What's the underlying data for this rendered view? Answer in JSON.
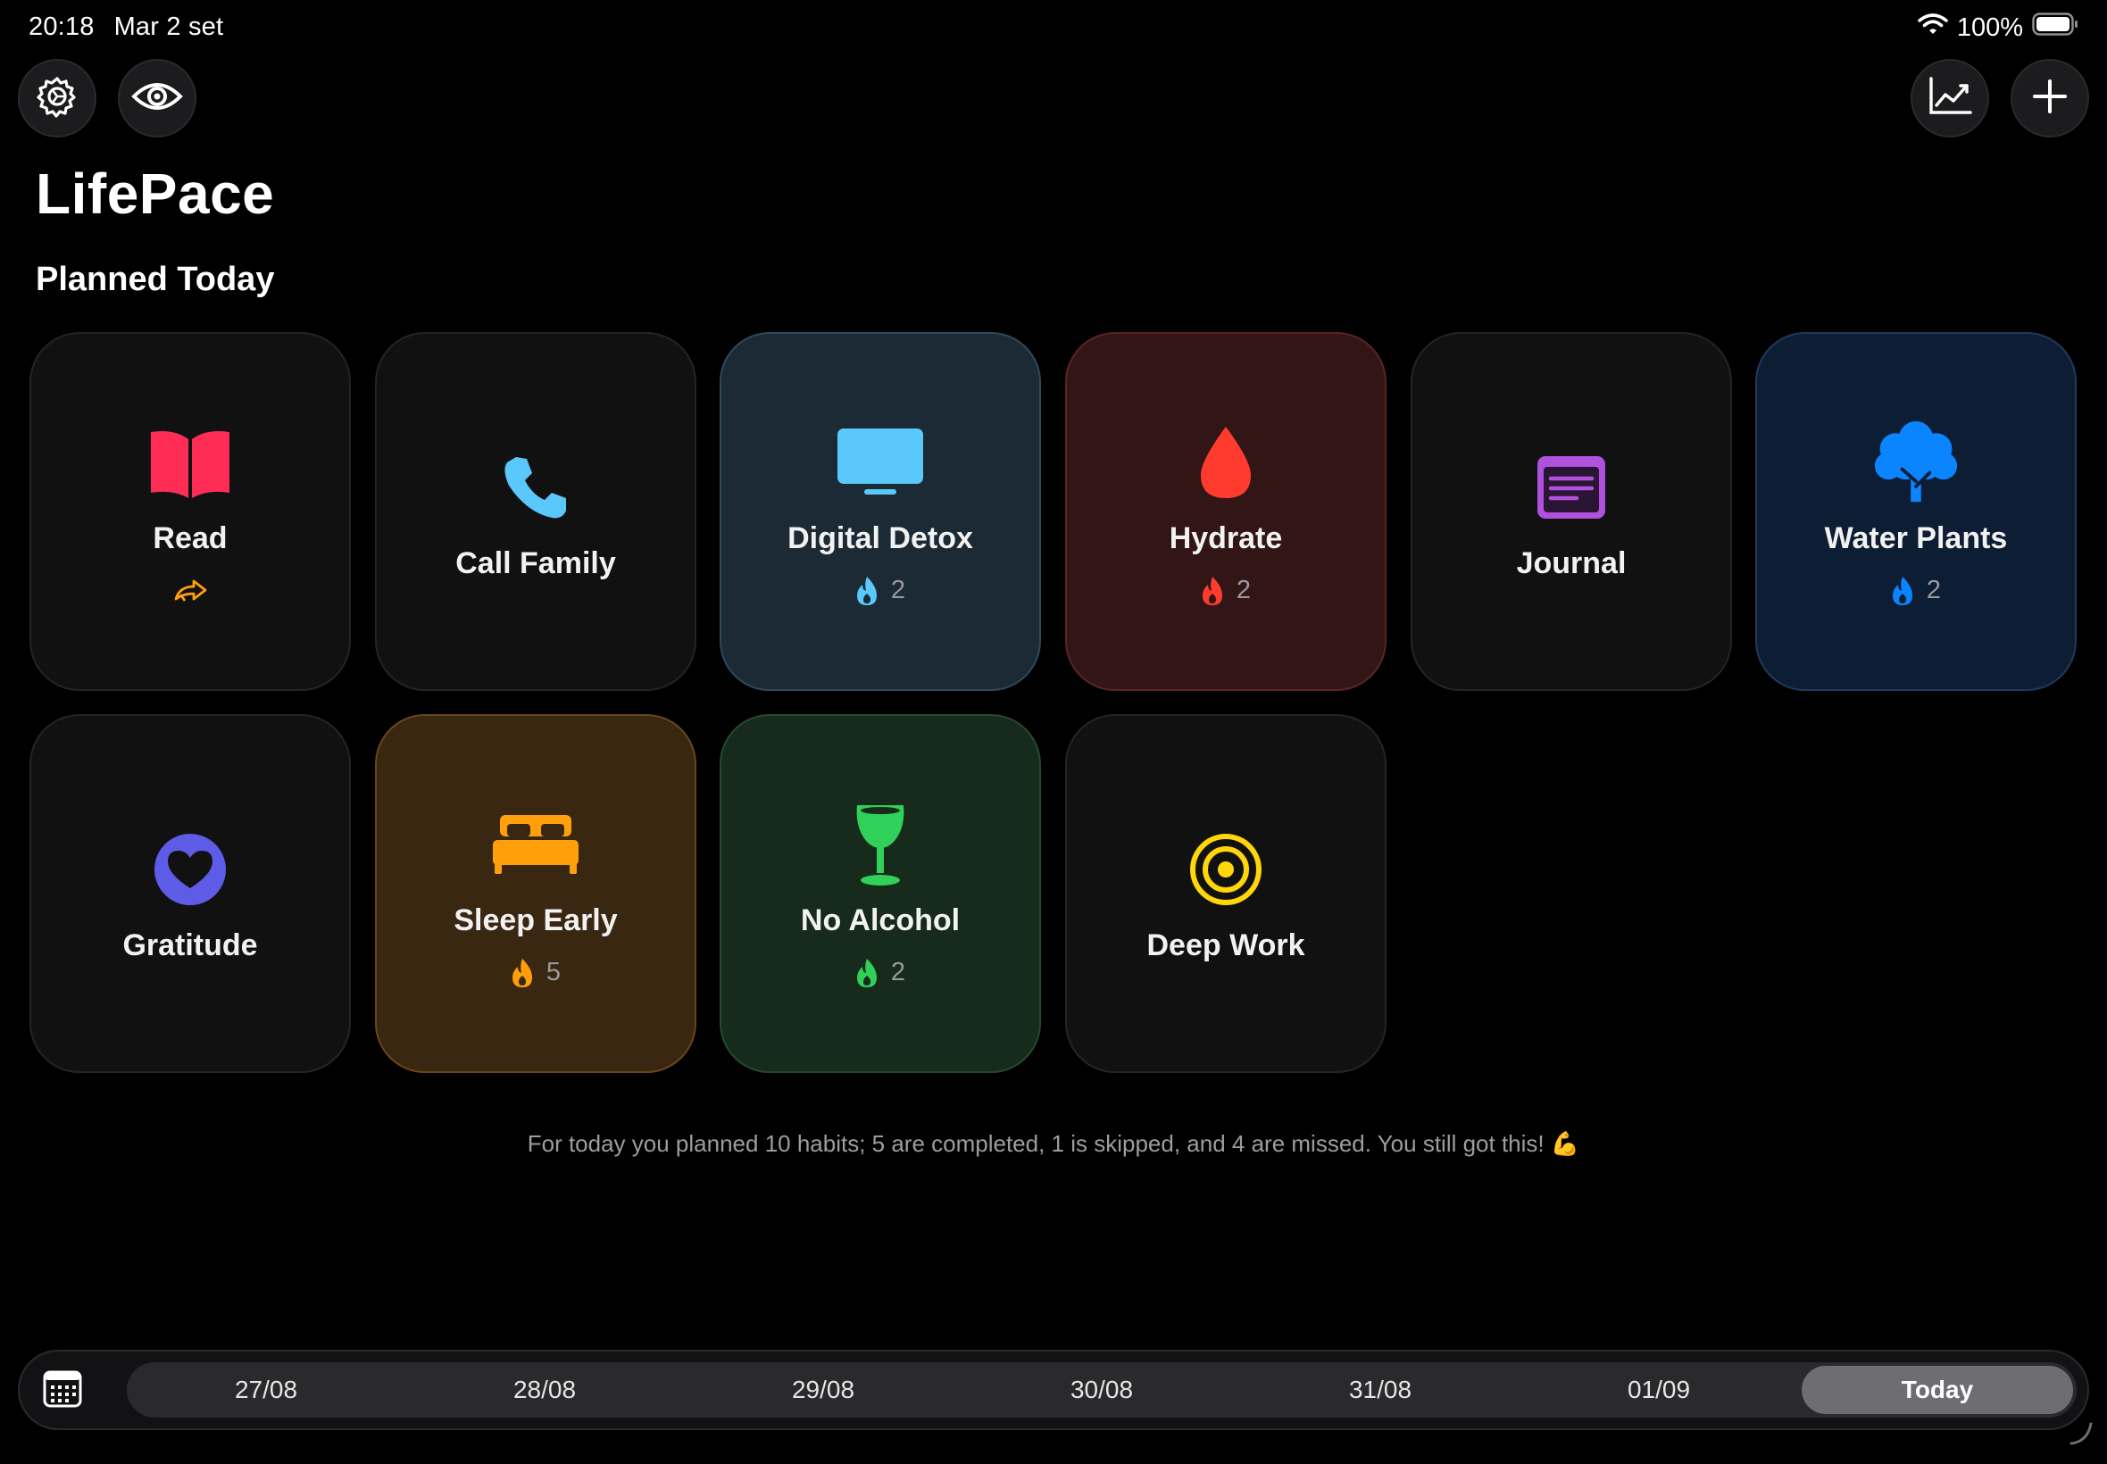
{
  "status_bar": {
    "time": "20:18",
    "date": "Mar 2 set",
    "battery": "100%"
  },
  "toolbar": {
    "settings_icon": "gear-icon",
    "visibility_icon": "eye-icon",
    "stats_icon": "chart-line-icon",
    "add_icon": "plus-icon"
  },
  "app_title": "LifePace",
  "section_title": "Planned Today",
  "habits": [
    {
      "label": "Read",
      "icon": "book-icon",
      "color": "#ff2d55",
      "streak_icon": "skip-arrow-icon",
      "streak": ""
    },
    {
      "label": "Call Family",
      "icon": "phone-icon",
      "color": "#5ac8fa",
      "streak": ""
    },
    {
      "label": "Digital Detox",
      "icon": "monitor-icon",
      "color": "#5ac8fa",
      "streak_icon": "flame-icon",
      "streak": "2"
    },
    {
      "label": "Hydrate",
      "icon": "drop-icon",
      "color": "#ff3b30",
      "streak_icon": "flame-icon",
      "streak": "2"
    },
    {
      "label": "Journal",
      "icon": "note-icon",
      "color": "#af52de",
      "streak": ""
    },
    {
      "label": "Water Plants",
      "icon": "tree-icon",
      "color": "#0a84ff",
      "streak_icon": "flame-icon",
      "streak": "2"
    },
    {
      "label": "Gratitude",
      "icon": "heart-circle-icon",
      "color": "#5e5ce6",
      "streak": ""
    },
    {
      "label": "Sleep Early",
      "icon": "bed-icon",
      "color": "#ff9f0a",
      "streak_icon": "flame-icon",
      "streak": "5"
    },
    {
      "label": "No Alcohol",
      "icon": "wineglass-icon",
      "color": "#30d158",
      "streak_icon": "flame-icon",
      "streak": "2"
    },
    {
      "label": "Deep Work",
      "icon": "target-icon",
      "color": "#ffd60a",
      "streak": ""
    }
  ],
  "summary": "For today you planned 10 habits; 5 are completed, 1 is skipped, and 4 are missed. You still got this! 💪",
  "date_bar": {
    "calendar_icon": "calendar-icon",
    "dates": [
      "27/08",
      "28/08",
      "29/08",
      "30/08",
      "31/08",
      "01/09",
      "Today"
    ],
    "selected": "Today"
  }
}
